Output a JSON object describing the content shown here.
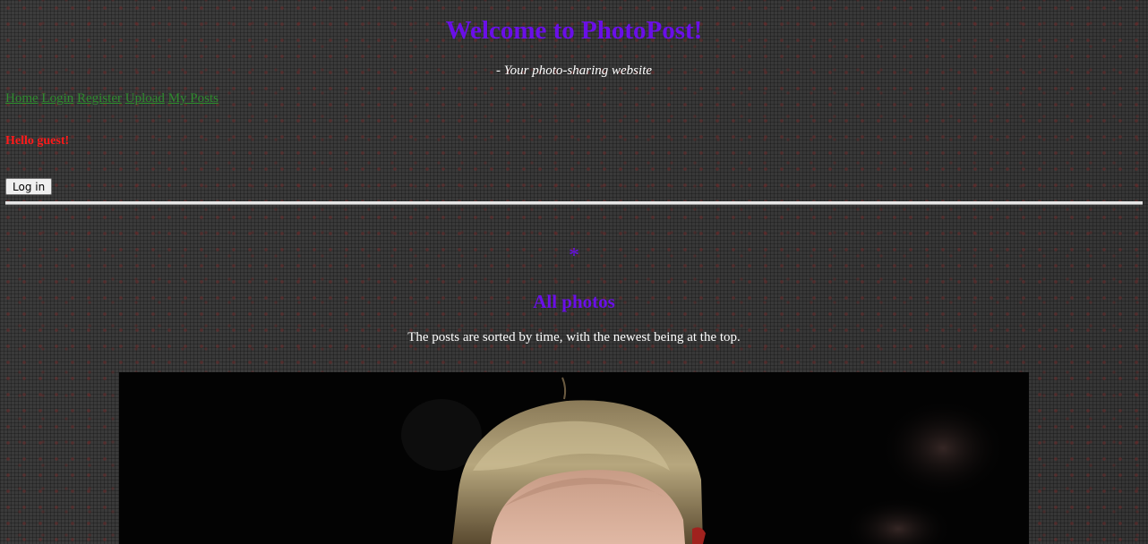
{
  "header": {
    "title": "Welcome to PhotoPost!",
    "tagline": "- Your photo-sharing website"
  },
  "nav": {
    "items": [
      {
        "label": "Home"
      },
      {
        "label": "Login"
      },
      {
        "label": "Register"
      },
      {
        "label": "Upload"
      },
      {
        "label": "My Posts"
      }
    ]
  },
  "user": {
    "greeting": "Hello guest!",
    "login_button_label": "Log in"
  },
  "main": {
    "star_glyph": "*",
    "section_title": "All photos",
    "section_note": "The posts are sorted by time, with the newest being at the top."
  },
  "colors": {
    "title": "#6a0fe8",
    "nav_link": "#2e8b2e",
    "greeting": "#ff1a1a",
    "text": "#ffffff"
  }
}
